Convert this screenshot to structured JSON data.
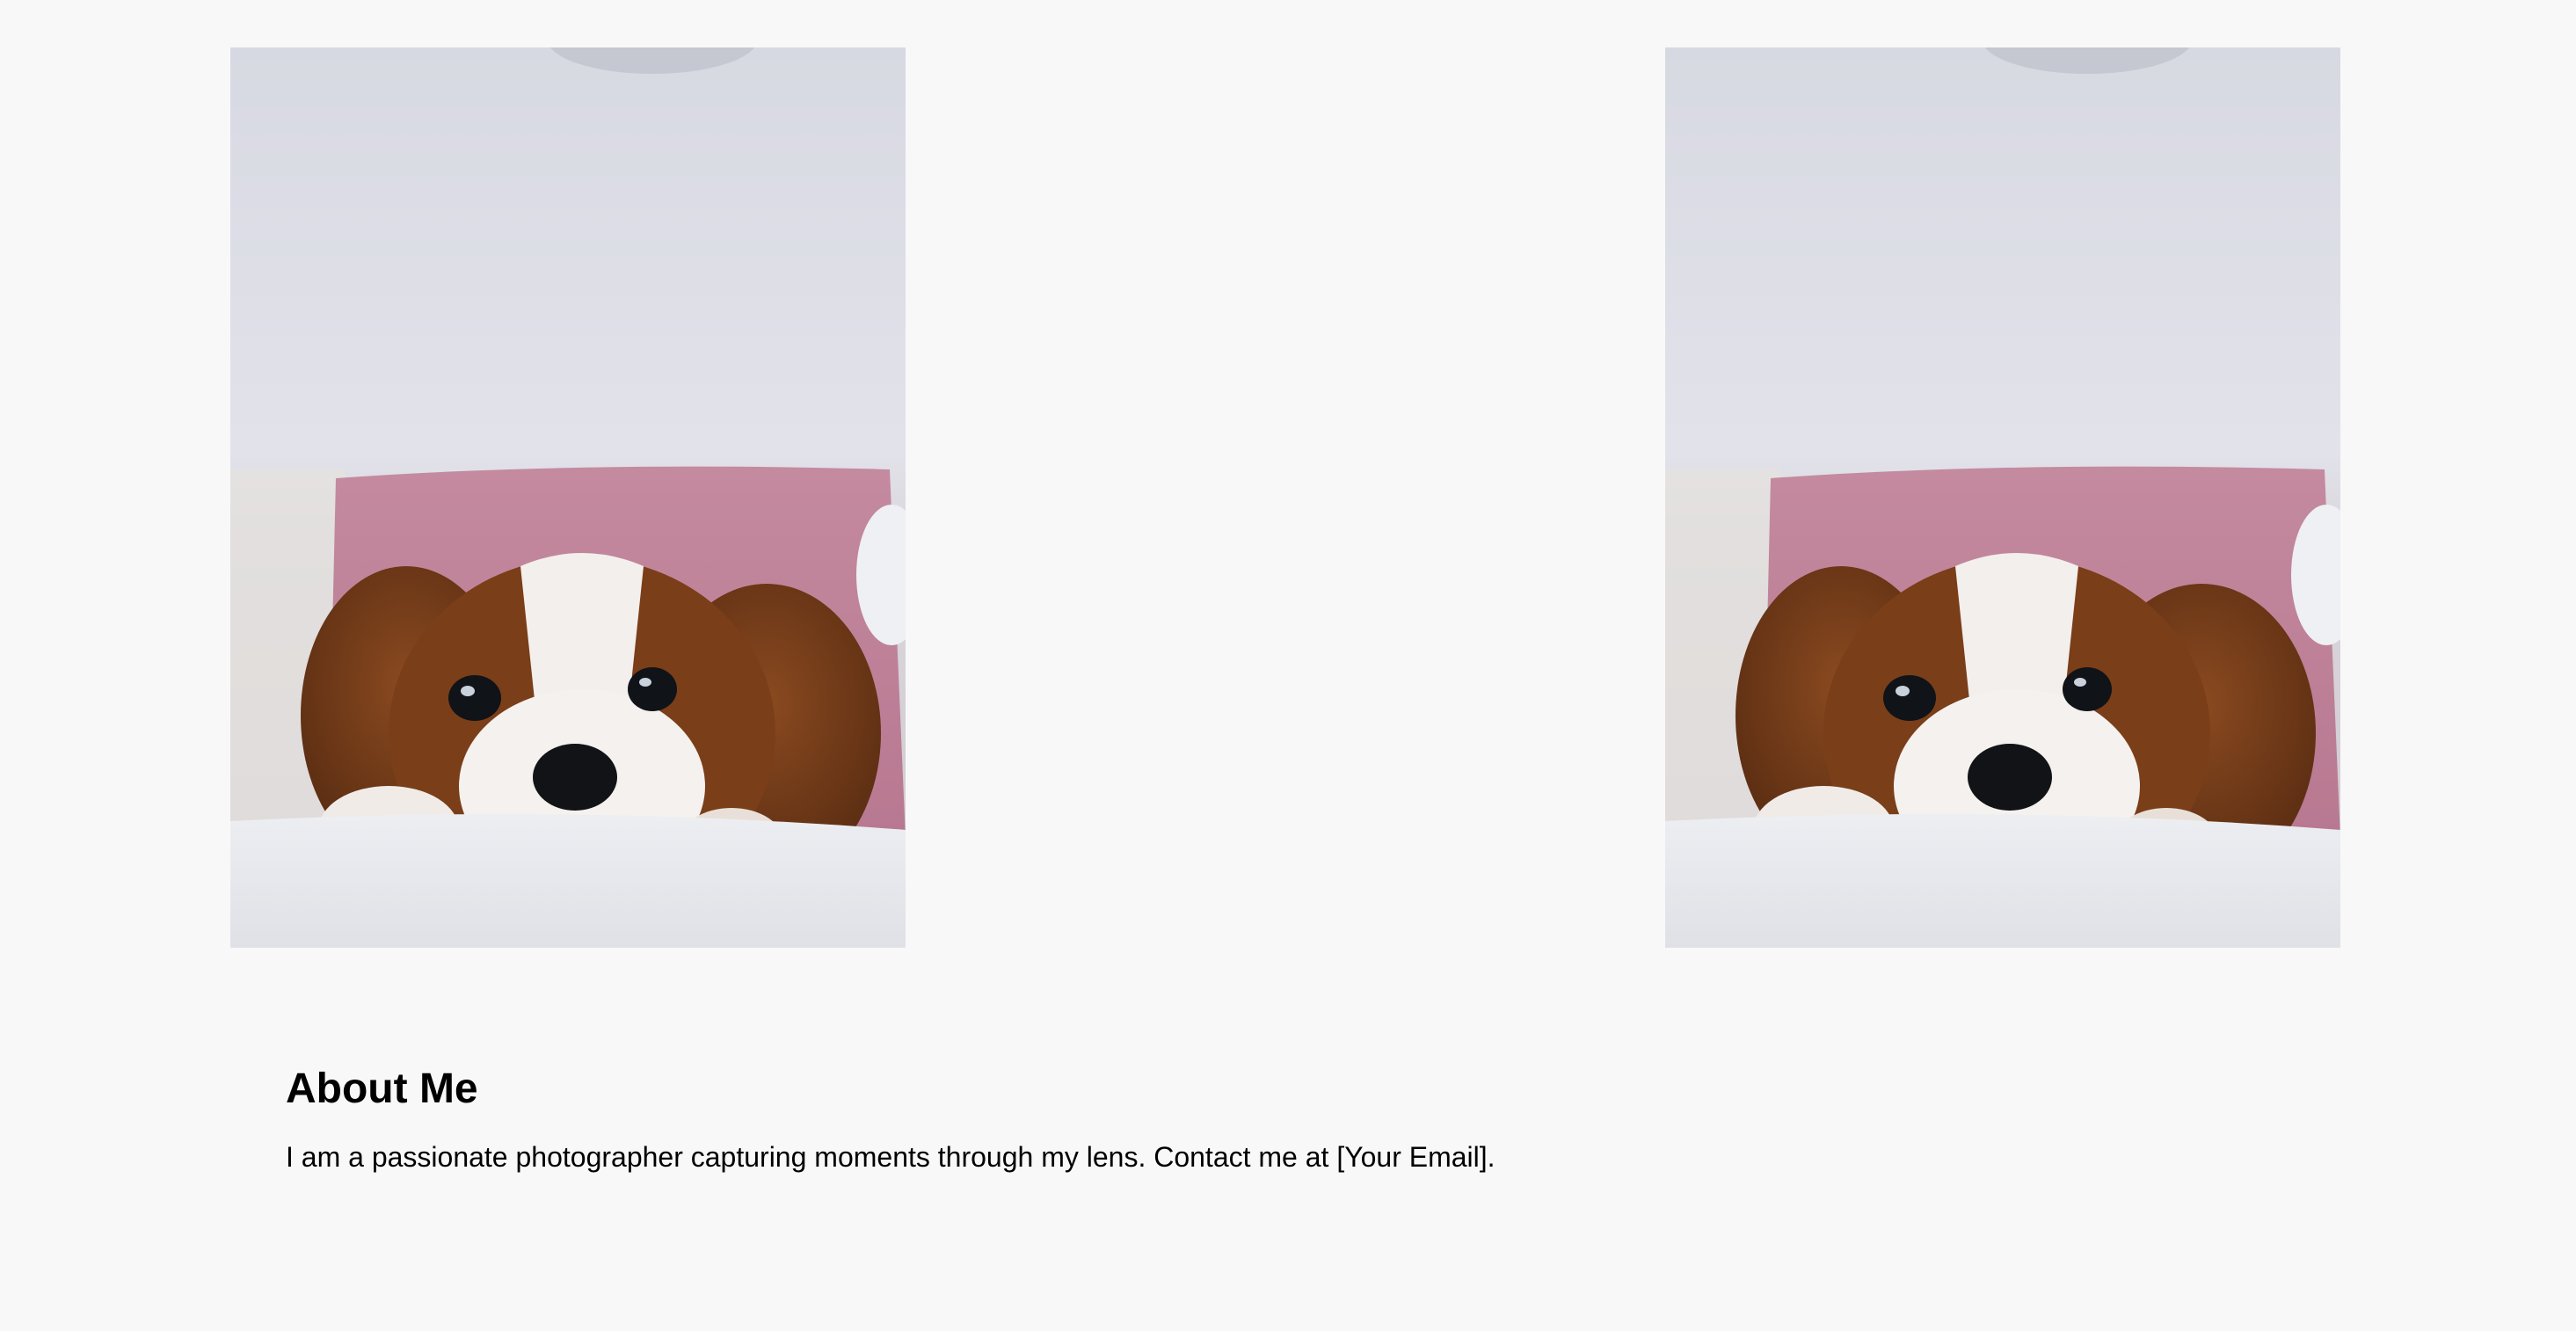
{
  "gallery": {
    "photos": [
      {
        "alt": "puppy-photo"
      },
      {
        "alt": "puppy-photo"
      }
    ]
  },
  "about": {
    "heading": "About Me",
    "body": "I am a passionate photographer capturing moments through my lens. Contact me at [Your Email]."
  },
  "colors": {
    "background": "#f8f8f8",
    "text": "#000000"
  }
}
